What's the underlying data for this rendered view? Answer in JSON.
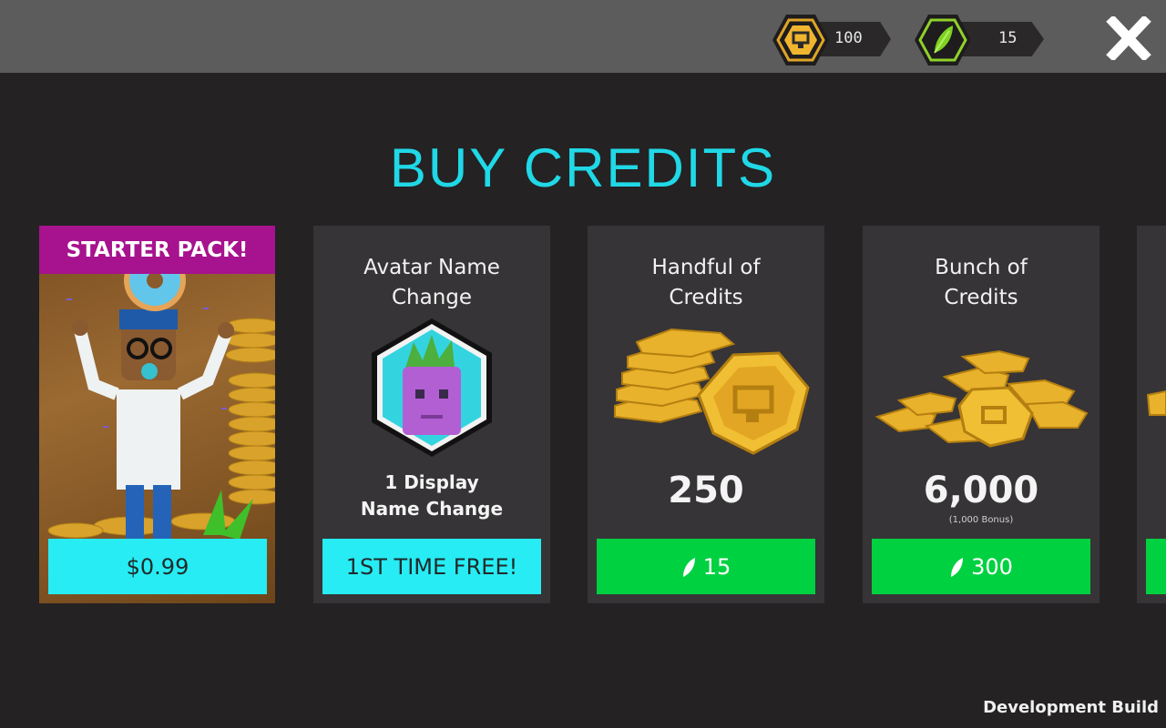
{
  "header": {
    "credits_value": "100",
    "gems_value": "15",
    "credits_icon": "credit-hex-icon",
    "gems_icon": "leaf-gem-icon",
    "close_icon": "close-icon"
  },
  "page": {
    "title": "BUY CREDITS"
  },
  "cards": [
    {
      "banner": "STARTER PACK!",
      "button_label": "$0.99",
      "image": "starter-pack-character-art"
    },
    {
      "title": "Avatar Name\nChange",
      "subtitle": "1 Display\nName Change",
      "button_label": "1ST TIME FREE!",
      "image": "avatar-head-hex-icon"
    },
    {
      "title": "Handful of\nCredits",
      "amount": "250",
      "button_price": "15",
      "image": "coin-stack-icon"
    },
    {
      "title": "Bunch of\nCredits",
      "amount": "6,000",
      "bonus": "(1,000 Bonus)",
      "button_price": "300",
      "image": "coin-pile-icon"
    }
  ],
  "footer": {
    "build_label": "Development Build"
  },
  "colors": {
    "accent": "#20d8e6",
    "buy_green": "#00d141",
    "buy_cyan": "#27ecf3",
    "starter_banner": "#a7128e"
  }
}
